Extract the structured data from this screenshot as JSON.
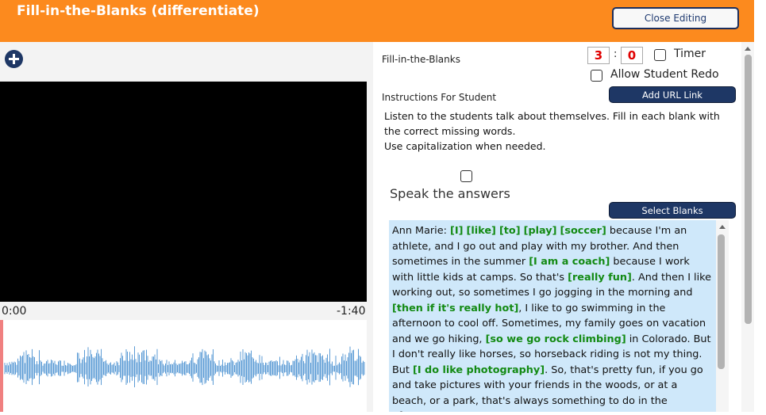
{
  "header": {
    "title": "Fill-in-the-Blanks (differentiate)",
    "close_label": "Close Editing"
  },
  "colors": {
    "header_bg": "#fc8a1e",
    "button_navy": "#1e3765",
    "blank_green": "#138a13",
    "text_bg": "#cfe8fa",
    "timer_red": "#e00000",
    "waveform": "#5b9bd5"
  },
  "media": {
    "time_current": "0:00",
    "time_remaining": "-1:40",
    "playhead_fraction": 0.0
  },
  "settings": {
    "activity_label": "Fill-in-the-Blanks",
    "timer_minutes": "3",
    "timer_seconds": "0",
    "timer_label": "Timer",
    "redo_label": "Allow Student Redo",
    "instructions_label": "Instructions For Student",
    "add_url_label": "Add URL Link",
    "speak_label": "Speak the answers",
    "select_blanks_label": "Select Blanks"
  },
  "instructions": {
    "line1": "Listen to the students talk about themselves. Fill in each blank with the correct missing words.",
    "line2": "Use capitalization when needed."
  },
  "passage": {
    "s0": "Ann Marie: ",
    "b1": "[I]",
    "s1": " ",
    "b2": "[like]",
    "s2": " ",
    "b3": "[to]",
    "s3": " ",
    "b4": "[play]",
    "s4": " ",
    "b5": "[soccer]",
    "s5": " because I'm an athlete, and I go out and play with my brother. And then sometimes in the summer ",
    "b6": "[I am a coach]",
    "s6": " because I work with little kids at camps. So that's ",
    "b7": "[really fun]",
    "s7": ". And then I like working out, so sometimes I go jogging in the morning and ",
    "b8": "[then if it's really hot]",
    "s8": ", I like to go swimming in the afternoon to cool off. Sometimes, my family goes on vacation and we go hiking, ",
    "b9": "[so we go rock climbing]",
    "s9": " in Colorado. But I don't really like horses, so horseback riding is not my thing. But ",
    "b10": "[I do like photography]",
    "s10": ". So, that's pretty fun, if you go and take pictures with your friends in the woods, or at a beach, or a park, that's always something to do in the afternoon."
  }
}
